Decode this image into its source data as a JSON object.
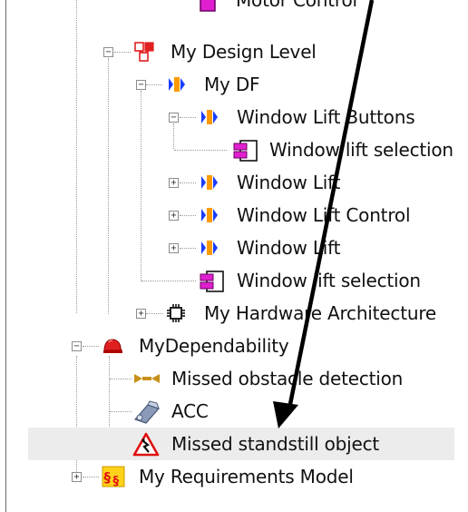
{
  "tree": {
    "top_partial_label": "Motor Control",
    "items": [
      {
        "label": "My Design Level",
        "icon": "design-level-icon"
      },
      {
        "label": "My DF",
        "icon": "functional-block-icon"
      },
      {
        "label": "Window Lift Buttons",
        "icon": "functional-block-icon"
      },
      {
        "label": "Window lift selection",
        "icon": "component-icon"
      },
      {
        "label": "Window Lift",
        "icon": "functional-block-icon"
      },
      {
        "label": "Window Lift Control",
        "icon": "functional-block-icon"
      },
      {
        "label": "Window Lift",
        "icon": "functional-block-icon"
      },
      {
        "label": "Window lift selection",
        "icon": "component-icon"
      },
      {
        "label": "My Hardware Architecture",
        "icon": "chip-icon"
      },
      {
        "label": "MyDependability",
        "icon": "helmet-icon"
      },
      {
        "label": "Missed obstacle detection",
        "icon": "failure-mode-icon"
      },
      {
        "label": "ACC",
        "icon": "sensor-icon"
      },
      {
        "label": "Missed standstill object",
        "icon": "hazard-warning-icon"
      },
      {
        "label": "My Requirements Model",
        "icon": "requirements-icon"
      }
    ]
  },
  "colors": {
    "magenta": "#e020d0",
    "blue": "#1a3cff",
    "orange": "#ff9900",
    "red": "#e02020",
    "selection": "#ececec"
  }
}
